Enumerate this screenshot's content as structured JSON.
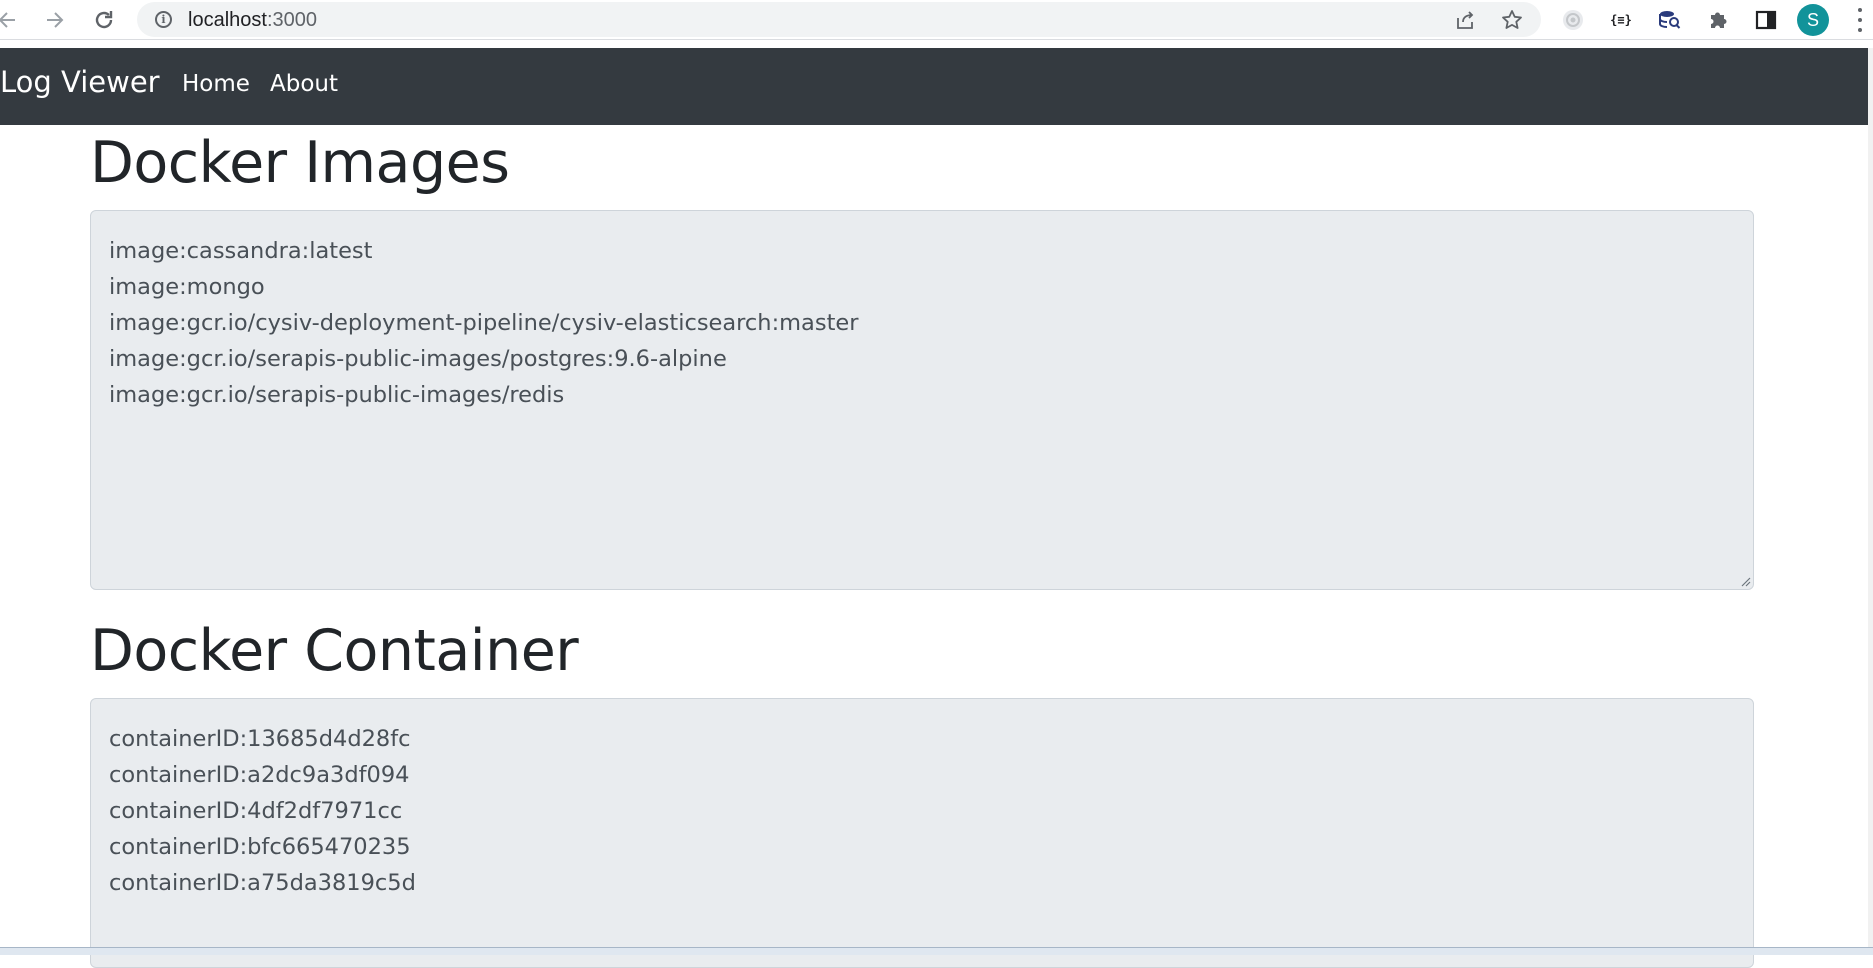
{
  "browser": {
    "url_host": "localhost",
    "url_port": ":3000",
    "avatar_initial": "S",
    "extension_json_label": "{≡}"
  },
  "navbar": {
    "brand": "Log Viewer",
    "links": [
      "Home",
      "About"
    ]
  },
  "images_section": {
    "title": "Docker Images",
    "lines": [
      "image:cassandra:latest",
      "image:mongo",
      "image:gcr.io/cysiv-deployment-pipeline/cysiv-elasticsearch:master",
      "image:gcr.io/serapis-public-images/postgres:9.6-alpine",
      "image:gcr.io/serapis-public-images/redis"
    ]
  },
  "containers_section": {
    "title": "Docker Container",
    "lines": [
      "containerID:13685d4d28fc",
      "containerID:a2dc9a3df094",
      "containerID:4df2df7971cc",
      "containerID:bfc665470235",
      "containerID:a75da3819c5d"
    ]
  },
  "colors": {
    "navbar_bg": "#343a40",
    "textarea_bg": "#e9ecef",
    "avatar_bg": "#12939a"
  }
}
